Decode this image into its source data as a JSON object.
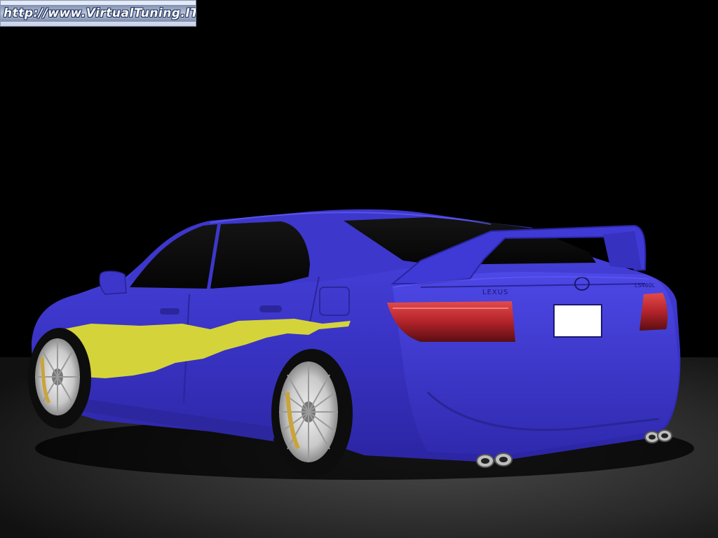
{
  "banner": {
    "text": "http://www.VirtualTuning.IT"
  },
  "car": {
    "badge": "LEXUS",
    "model_badge": "LS460L"
  },
  "colors": {
    "background": "#000000",
    "floor": "#3a3a3a",
    "body_paint": "#3b35c8",
    "decal": "#d4d43a",
    "tail_light": "#b0262a",
    "plate": "#ffffff"
  }
}
